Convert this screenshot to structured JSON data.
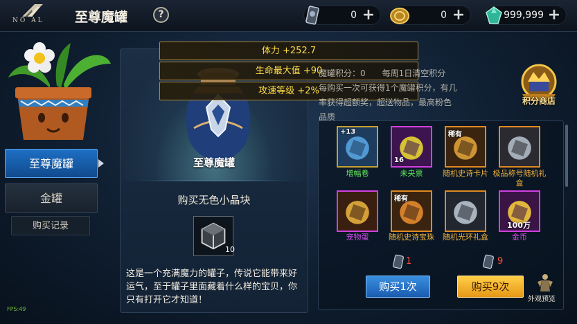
{
  "header": {
    "logo_text": "NO AL",
    "title": "至尊魔罐",
    "help": "?",
    "currencies": [
      {
        "icon": "ticket-icon",
        "value": "0"
      },
      {
        "icon": "gold-coin-icon",
        "value": "0"
      },
      {
        "icon": "emerald-gem-icon",
        "value": "999,999"
      }
    ],
    "plus": "+"
  },
  "sidebar": {
    "tabs": [
      {
        "label": "至尊魔罐",
        "active": true
      },
      {
        "label": "金罐",
        "active": false
      }
    ],
    "record": "购买记录",
    "fps": "FPS:49"
  },
  "stats": [
    {
      "label": "体力",
      "value": "+252.7"
    },
    {
      "label": "生命最大值",
      "value": "+90"
    },
    {
      "label": "攻速等级",
      "value": "+2%"
    }
  ],
  "jar_panel": {
    "jar_name": "至尊魔罐",
    "buy_crystal": "购买无色小晶块",
    "crystal_count": "10",
    "description": "这是一个充满魔力的罐子，传说它能带来好运气，至于罐子里面藏着什么样的宝贝，你只有打开它才知道！"
  },
  "info": {
    "points_label": "魔罐积分：",
    "points_value": "0",
    "reset_note": "每周1日清空积分",
    "line2": "每购买一次可获得1个魔罐积分，有几",
    "line3": "率获得超额奖，超送物品，最高粉色",
    "line4": "品质"
  },
  "points_shop": {
    "label": "积分商店"
  },
  "rewards": [
    {
      "name": "增幅卷",
      "badge": "+13",
      "tier": "green",
      "border": "#c8a030"
    },
    {
      "name": "未央票",
      "badge": "16",
      "tier": "green",
      "border": "#d040e0"
    },
    {
      "name": "随机史诗卡片",
      "badge": "稀有",
      "tier": "orange",
      "border": "#e08a20"
    },
    {
      "name": "极品称号随机礼盒",
      "badge": "",
      "tier": "orange",
      "border": "#e08a20"
    },
    {
      "name": "宠物蛋",
      "badge": "",
      "tier": "purple",
      "border": "#d040e0"
    },
    {
      "name": "随机史诗宝珠",
      "badge": "稀有",
      "tier": "orange",
      "border": "#e08a20"
    },
    {
      "name": "随机光环礼盒",
      "badge": "",
      "tier": "orange",
      "border": "#e08a20"
    },
    {
      "name": "金币",
      "badge": "100万",
      "tier": "purple",
      "border": "#d040e0"
    }
  ],
  "purchase": {
    "cost_1": "1",
    "cost_9": "9",
    "buy_1": "购买1次",
    "buy_9": "购买9次",
    "preview": "外观预览"
  }
}
